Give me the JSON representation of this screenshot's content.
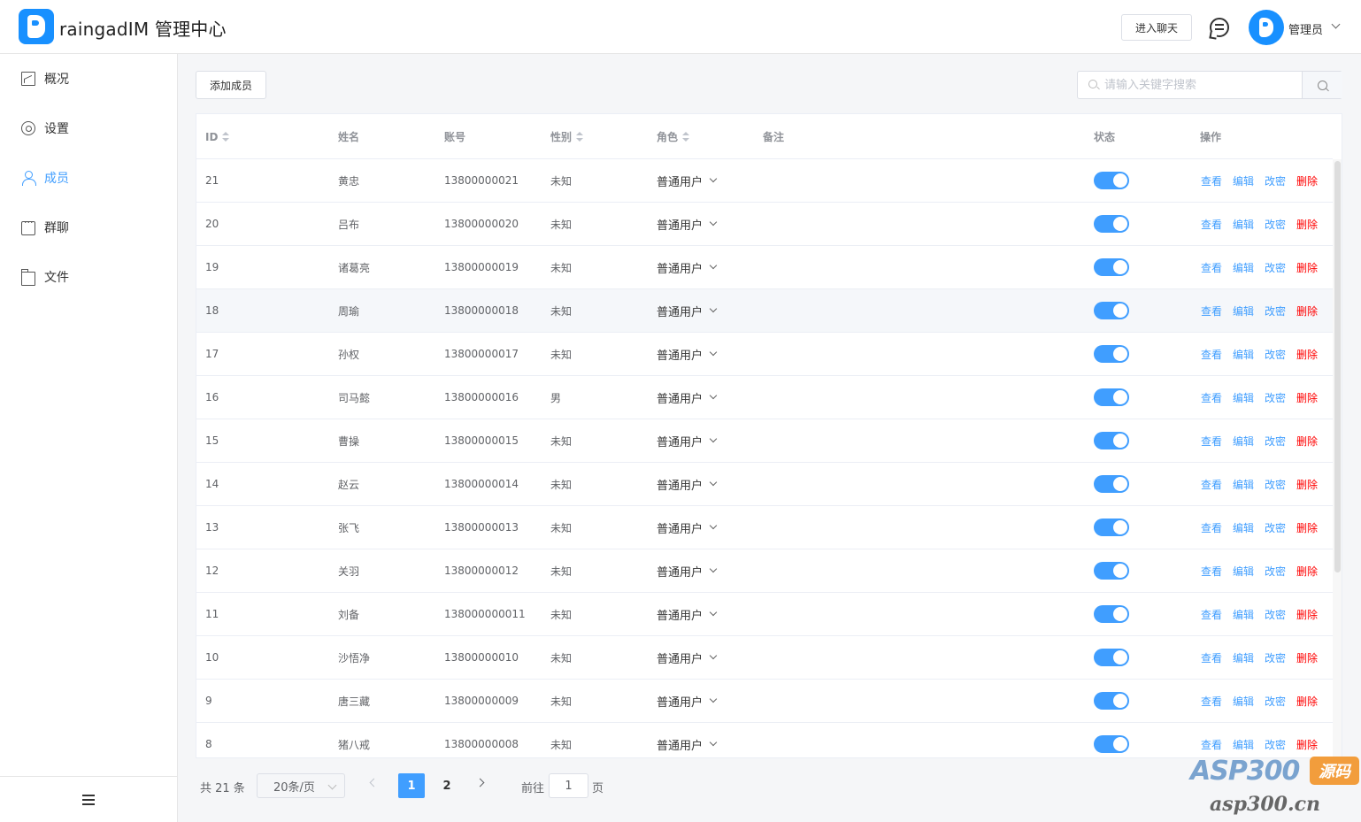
{
  "header": {
    "app_title": "raingadIM 管理中心",
    "enter_chat_label": "进入聊天",
    "user_name": "管理员"
  },
  "sidebar": {
    "items": [
      {
        "label": "概况",
        "icon": "dashboard-icon"
      },
      {
        "label": "设置",
        "icon": "gear-icon"
      },
      {
        "label": "成员",
        "icon": "user-icon",
        "active": true
      },
      {
        "label": "群聊",
        "icon": "chat-icon"
      },
      {
        "label": "文件",
        "icon": "folder-icon"
      }
    ]
  },
  "toolbar": {
    "add_member_label": "添加成员",
    "search_placeholder": "请输入关键字搜索"
  },
  "table": {
    "columns": {
      "id": "ID",
      "name": "姓名",
      "account": "账号",
      "gender": "性别",
      "role": "角色",
      "remark": "备注",
      "status": "状态",
      "actions": "操作"
    },
    "action_labels": {
      "view": "查看",
      "edit": "编辑",
      "password": "改密",
      "delete": "删除"
    },
    "rows": [
      {
        "id": "21",
        "name": "黄忠",
        "account": "13800000021",
        "gender": "未知",
        "role": "普通用户",
        "status": true
      },
      {
        "id": "20",
        "name": "吕布",
        "account": "13800000020",
        "gender": "未知",
        "role": "普通用户",
        "status": true
      },
      {
        "id": "19",
        "name": "诸葛亮",
        "account": "13800000019",
        "gender": "未知",
        "role": "普通用户",
        "status": true
      },
      {
        "id": "18",
        "name": "周瑜",
        "account": "13800000018",
        "gender": "未知",
        "role": "普通用户",
        "status": true
      },
      {
        "id": "17",
        "name": "孙权",
        "account": "13800000017",
        "gender": "未知",
        "role": "普通用户",
        "status": true
      },
      {
        "id": "16",
        "name": "司马懿",
        "account": "13800000016",
        "gender": "男",
        "role": "普通用户",
        "status": true
      },
      {
        "id": "15",
        "name": "曹操",
        "account": "13800000015",
        "gender": "未知",
        "role": "普通用户",
        "status": true
      },
      {
        "id": "14",
        "name": "赵云",
        "account": "13800000014",
        "gender": "未知",
        "role": "普通用户",
        "status": true
      },
      {
        "id": "13",
        "name": "张飞",
        "account": "13800000013",
        "gender": "未知",
        "role": "普通用户",
        "status": true
      },
      {
        "id": "12",
        "name": "关羽",
        "account": "13800000012",
        "gender": "未知",
        "role": "普通用户",
        "status": true
      },
      {
        "id": "11",
        "name": "刘备",
        "account": "138000000011",
        "gender": "未知",
        "role": "普通用户",
        "status": true
      },
      {
        "id": "10",
        "name": "沙悟净",
        "account": "13800000010",
        "gender": "未知",
        "role": "普通用户",
        "status": true
      },
      {
        "id": "9",
        "name": "唐三藏",
        "account": "13800000009",
        "gender": "未知",
        "role": "普通用户",
        "status": true
      },
      {
        "id": "8",
        "name": "猪八戒",
        "account": "13800000008",
        "gender": "未知",
        "role": "普通用户",
        "status": true
      }
    ]
  },
  "pagination": {
    "total_label": "共 21 条",
    "page_size_label": "20条/页",
    "pages": [
      "1",
      "2"
    ],
    "current_page": "1",
    "goto_label": "前往",
    "goto_value": "1",
    "page_suffix": "页"
  },
  "watermark": {
    "brand": "ASP300",
    "tag": "源码",
    "url": "asp300.cn"
  }
}
